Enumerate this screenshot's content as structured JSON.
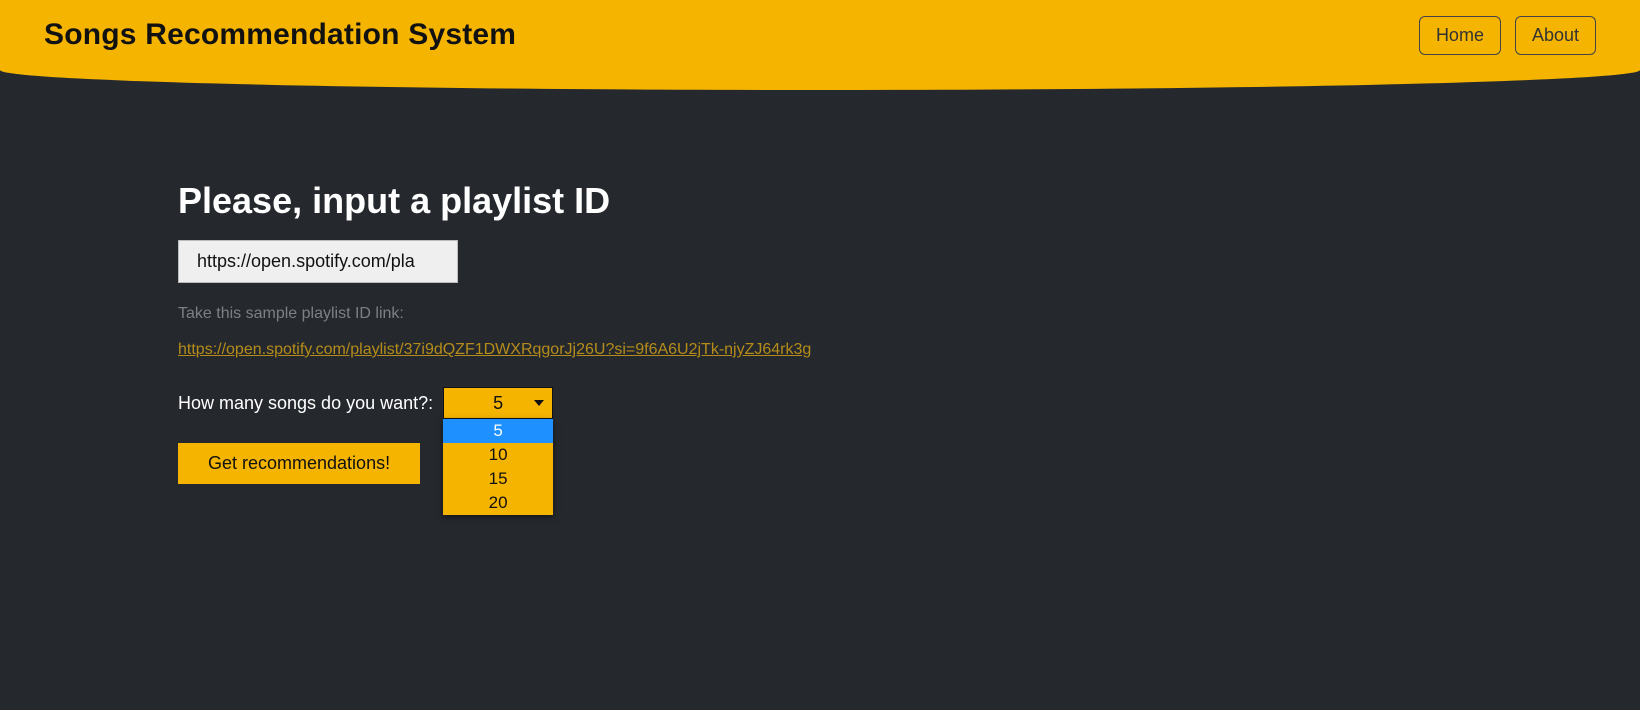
{
  "header": {
    "title": "Songs Recommendation System",
    "nav": {
      "home": "Home",
      "about": "About"
    }
  },
  "main": {
    "heading": "Please, input a playlist ID",
    "url_input_value": "https://open.spotify.com/pla",
    "helper_text": "Take this sample playlist ID link:",
    "sample_link": "https://open.spotify.com/playlist/37i9dQZF1DWXRqgorJj26U?si=9f6A6U2jTk-njyZJ64rk3g",
    "song_count": {
      "label": "How many songs do you want?:",
      "selected": "5",
      "options": [
        "5",
        "10",
        "15",
        "20"
      ],
      "highlighted_index": 0
    },
    "submit_label": "Get recommendations!"
  },
  "colors": {
    "yellow": "#f4b400",
    "dark": "#25292e",
    "link": "#b58c19",
    "highlight_blue": "#1e90ff"
  }
}
